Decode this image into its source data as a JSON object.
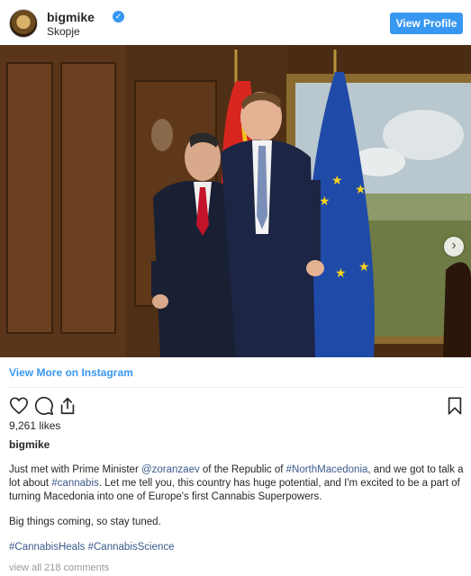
{
  "header": {
    "username": "bigmike",
    "location": "Skopje",
    "view_profile": "View Profile"
  },
  "photo": {
    "next_arrow": "›"
  },
  "view_more": "View More on Instagram",
  "likes": "9,261 likes",
  "author": "bigmike",
  "caption": {
    "t1": "Just met with Prime Minister ",
    "mention": "@zoranzaev",
    "t2": " of the Republic of ",
    "tag1": "#NorthMacedonia",
    "t3": ", and we got to talk a lot about ",
    "tag2": "#cannabis",
    "t4": ". Let me tell you, this country has huge potential, and I'm excited to be a part of turning Macedonia into one of Europe's first Cannabis Superpowers.",
    "p2": "Big things coming, so stay tuned.",
    "tag3": "#CannabisHeals",
    "tag4": "#CannabisScience"
  },
  "comments_link": "view all 218 comments",
  "colors": {
    "accent": "#3897f0",
    "link": "#3b5a8b",
    "muted": "#999999"
  }
}
